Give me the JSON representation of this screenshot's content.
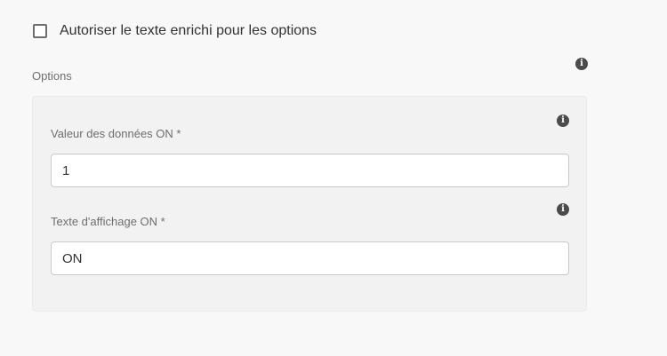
{
  "rich_text_option": {
    "label": "Autoriser le texte enrichi pour les options",
    "checked": false
  },
  "options": {
    "label": "Options",
    "info_icon": "info-icon",
    "fields": [
      {
        "label": "Valeur des données ON *",
        "value": "1",
        "info_icon": "info-icon"
      },
      {
        "label": "Texte d'affichage ON *",
        "value": "ON",
        "info_icon": "info-icon"
      }
    ]
  },
  "colors": {
    "background": "#f8f8f8",
    "panel": "#f2f2f2",
    "text": "#323232",
    "label": "#6e6e6e",
    "icon": "#4b4b4b"
  }
}
